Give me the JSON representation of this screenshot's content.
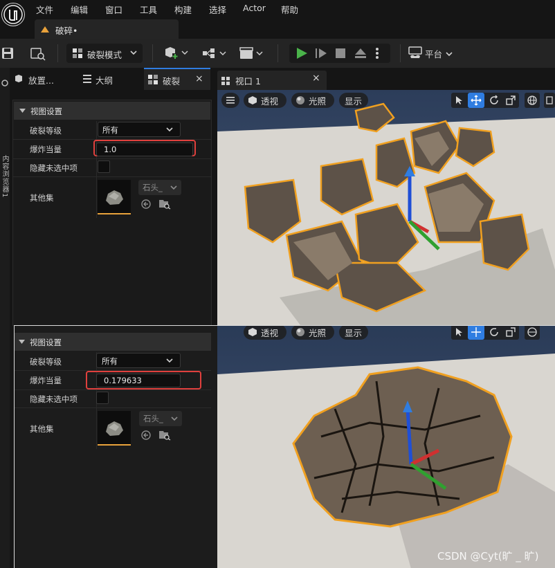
{
  "menu": {
    "items": [
      "文件",
      "编辑",
      "窗口",
      "工具",
      "构建",
      "选择",
      "Actor",
      "帮助"
    ]
  },
  "doc_tab": {
    "label": "破碎•"
  },
  "toolbar": {
    "mode_label": "破裂模式",
    "platform_label": "平台"
  },
  "left_strip": {
    "label": "内容浏览器1"
  },
  "panel_tabs": [
    {
      "label": "放置..."
    },
    {
      "label": "大纲"
    },
    {
      "label": "破裂",
      "close": "×"
    }
  ],
  "viewport_tab": {
    "label": "视口 1",
    "close": "×"
  },
  "viewport_toolbar": {
    "perspective": "透视",
    "lighting": "光照",
    "show": "显示"
  },
  "details_top": {
    "section": "视图设置",
    "rows": {
      "fracture_level_label": "破裂等级",
      "fracture_level_value": "所有",
      "explode_label": "爆炸当量",
      "explode_value": "1.0",
      "hide_unselected_label": "隐藏未选中项",
      "other_sets_label": "其他集",
      "asset_combo": "石头_"
    }
  },
  "details_bottom": {
    "section": "视图设置",
    "rows": {
      "fracture_level_label": "破裂等级",
      "fracture_level_value": "所有",
      "explode_label": "爆炸当量",
      "explode_value": "0.179633",
      "hide_unselected_label": "隐藏未选中项",
      "other_sets_label": "其他集",
      "asset_combo": "石头_"
    }
  },
  "watermark": "CSDN @Cyt(旷 _ 旷)",
  "colors": {
    "accent": "#2f7de1",
    "highlight_box": "#e0403d",
    "selection_outline": "#f0a020",
    "play_green": "#4ab34a"
  },
  "icons": [
    "unreal-logo-icon",
    "save-icon",
    "content-browser-icon",
    "fracture-mode-icon",
    "add-actor-icon",
    "blueprint-icon",
    "cinematics-icon",
    "play-icon",
    "step-icon",
    "stop-icon",
    "eject-icon",
    "more-icon",
    "platform-icon",
    "hamburger-icon",
    "cube-icon",
    "sphere-icon",
    "select-icon",
    "translate-icon",
    "rotate-icon",
    "scale-icon",
    "globe-icon"
  ]
}
